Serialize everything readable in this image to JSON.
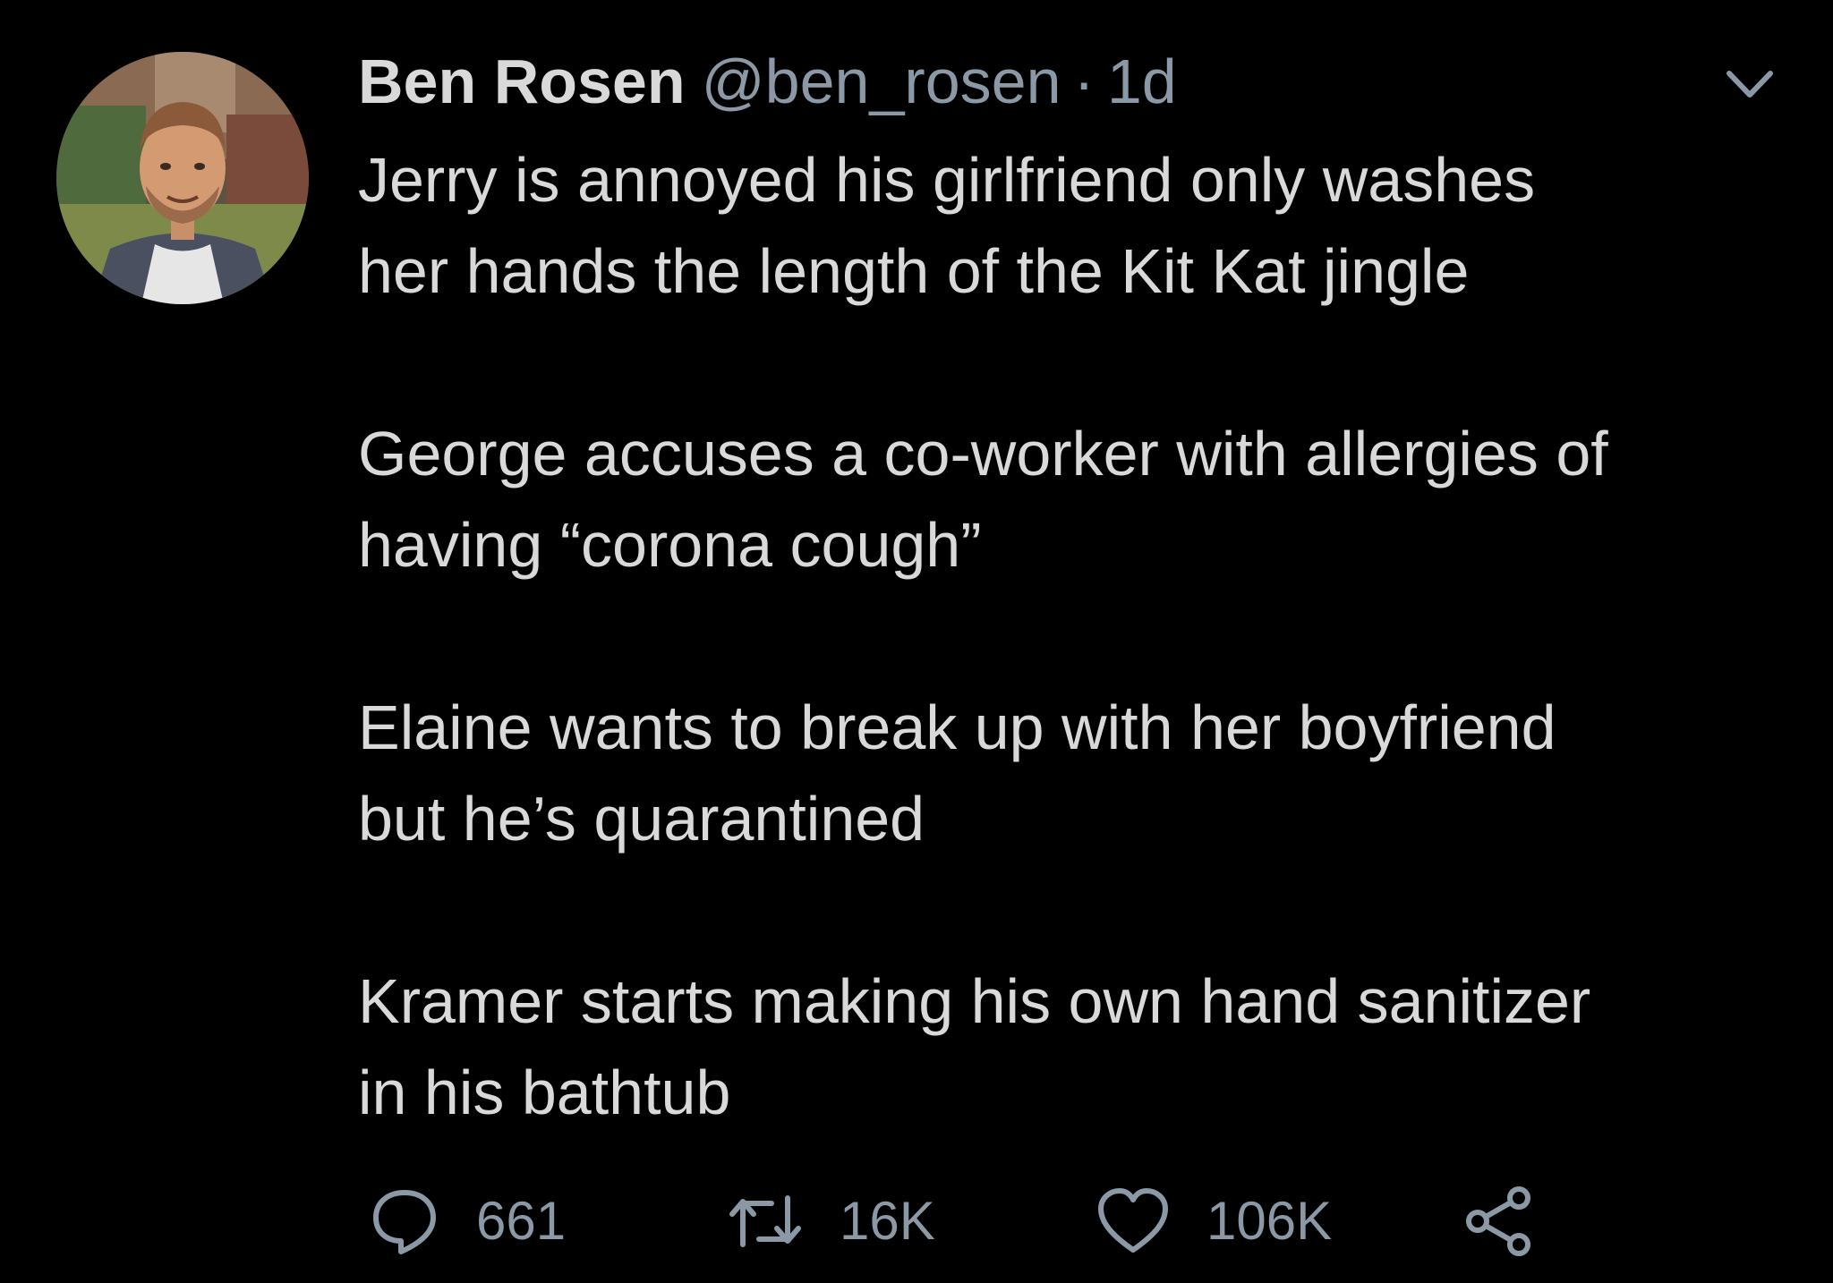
{
  "tweet": {
    "display_name": "Ben Rosen",
    "handle": "@ben_rosen",
    "separator": "·",
    "time": "1d",
    "paragraphs": [
      "Jerry is annoyed his girlfriend only washes\nher hands the length of the Kit Kat jingle",
      "George accuses a co-worker with allergies of\nhaving “corona cough”",
      "Elaine wants to break up with her boyfriend\nbut he’s quarantined",
      "Kramer starts making his own hand sanitizer\nin his bathtub"
    ],
    "actions": {
      "reply_count": "661",
      "retweet_count": "16K",
      "like_count": "106K"
    }
  },
  "icons": {
    "reply": "reply-icon",
    "retweet": "retweet-icon",
    "like": "heart-icon",
    "share": "share-icon",
    "menu": "chevron-down-icon"
  },
  "colors": {
    "background": "#000000",
    "primary_text": "#d9d9d9",
    "secondary_text": "#8b98a5"
  }
}
